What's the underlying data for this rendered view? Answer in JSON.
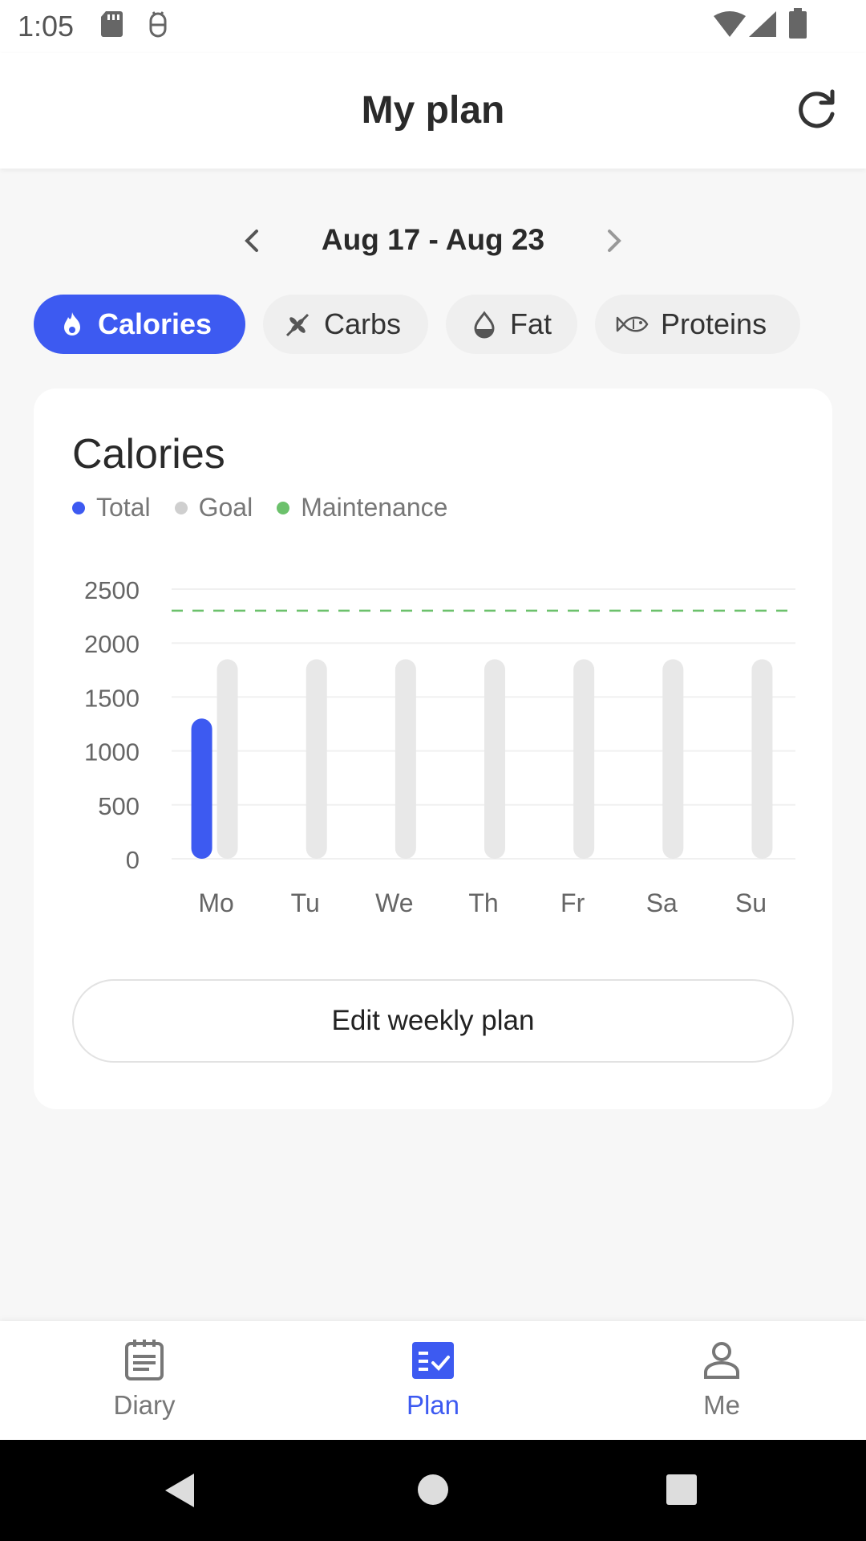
{
  "status_bar": {
    "time": "1:05"
  },
  "app_bar": {
    "title": "My plan",
    "refresh_icon": "refresh-icon"
  },
  "week": {
    "label": "Aug 17 - Aug 23"
  },
  "filters": [
    {
      "label": "Calories",
      "icon": "flame-icon",
      "active": true
    },
    {
      "label": "Carbs",
      "icon": "wheat-icon",
      "active": false
    },
    {
      "label": "Fat",
      "icon": "drop-icon",
      "active": false
    },
    {
      "label": "Proteins",
      "icon": "fish-icon",
      "active": false
    }
  ],
  "card": {
    "title": "Calories",
    "legend": [
      {
        "label": "Total",
        "color": "#3d5af1"
      },
      {
        "label": "Goal",
        "color": "#cfcfcf"
      },
      {
        "label": "Maintenance",
        "color": "#6cc16c"
      }
    ],
    "edit_button": "Edit weekly plan"
  },
  "chart_data": {
    "type": "bar",
    "categories": [
      "Mo",
      "Tu",
      "We",
      "Th",
      "Fr",
      "Sa",
      "Su"
    ],
    "series": [
      {
        "name": "Total",
        "values": [
          1300,
          0,
          0,
          0,
          0,
          0,
          0
        ],
        "color": "#3d5af1"
      },
      {
        "name": "Goal",
        "values": [
          1850,
          1850,
          1850,
          1850,
          1850,
          1850,
          1850
        ],
        "color": "#e8e8e8"
      }
    ],
    "maintenance": {
      "name": "Maintenance",
      "value": 2300,
      "color": "#6cc16c"
    },
    "y_ticks": [
      0,
      500,
      1000,
      1500,
      2000,
      2500
    ],
    "ylim": [
      0,
      2500
    ],
    "title": "Calories",
    "xlabel": "",
    "ylabel": "",
    "grid": true,
    "legend_position": "top-left"
  },
  "bottom_nav": [
    {
      "label": "Diary",
      "icon": "diary-icon",
      "active": false
    },
    {
      "label": "Plan",
      "icon": "plan-icon",
      "active": true
    },
    {
      "label": "Me",
      "icon": "person-icon",
      "active": false
    }
  ]
}
